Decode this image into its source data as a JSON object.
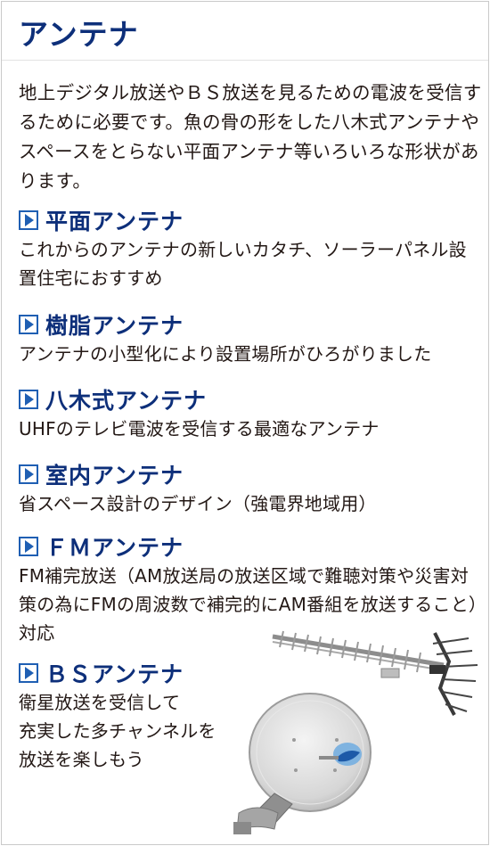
{
  "title": "アンテナ",
  "intro": "地上デジタル放送やＢＳ放送を見るための電波を受信するために必要です。魚の骨の形をした八木式アンテナやスペースをとらない平面アンテナ等いろいろな形状があります。",
  "sections": [
    {
      "title": "平面アンテナ",
      "desc": "これからのアンテナの新しいカタチ、ソーラーパネル設置住宅におすすめ"
    },
    {
      "title": "樹脂アンテナ",
      "desc": "アンテナの小型化により設置場所がひろがりました"
    },
    {
      "title": "八木式アンテナ",
      "desc": "UHFのテレビ電波を受信する最適なアンテナ"
    },
    {
      "title": "室内アンテナ",
      "desc": "省スペース設計のデザイン（強電界地域用）"
    },
    {
      "title": "ＦＭアンテナ",
      "desc": "FM補完放送（AM放送局の放送区域で難聴対策や災害対策の為にFMの周波数で補完的にAM番組を放送すること）対応"
    },
    {
      "title": "ＢＳアンテナ",
      "desc_lines": [
        "衛星放送を受信して",
        "充実した多チャンネルを",
        "放送を楽しもう"
      ]
    }
  ],
  "colors": {
    "heading": "#0d2f7a",
    "accent": "#1f5fb3",
    "text": "#231815",
    "border": "#c9c9c9"
  },
  "icons": [
    "play-triangle-icon",
    "yagi-antenna-image",
    "bs-dish-antenna-image"
  ]
}
